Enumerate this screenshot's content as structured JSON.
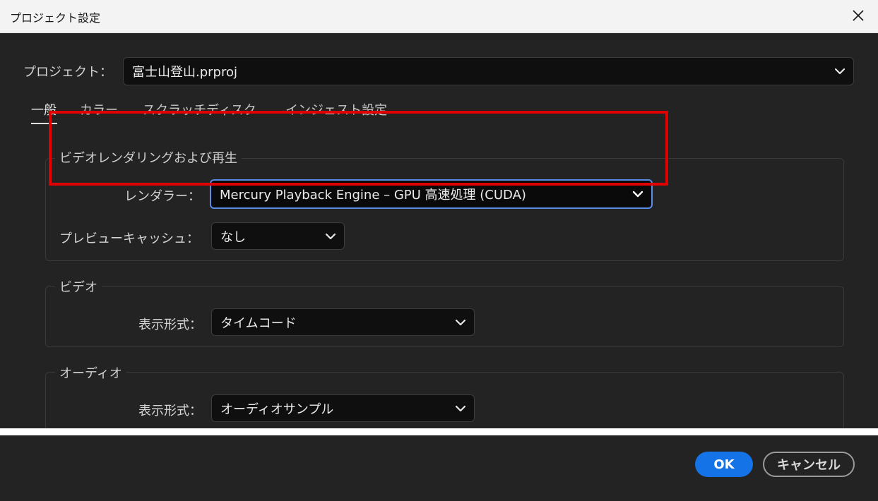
{
  "window": {
    "title": "プロジェクト設定"
  },
  "project": {
    "label": "プロジェクト：",
    "value": "富士山登山.prproj"
  },
  "tabs": [
    {
      "label": "一般",
      "active": true
    },
    {
      "label": "カラー",
      "active": false
    },
    {
      "label": "スクラッチディスク",
      "active": false
    },
    {
      "label": "インジェスト設定",
      "active": false
    }
  ],
  "video_rendering": {
    "title": "ビデオレンダリングおよび再生",
    "renderer_label": "レンダラー：",
    "renderer_value": "Mercury Playback Engine – GPU 高速処理 (CUDA)",
    "preview_cache_label": "プレビューキャッシュ：",
    "preview_cache_value": "なし"
  },
  "video": {
    "title": "ビデオ",
    "display_format_label": "表示形式：",
    "display_format_value": "タイムコード"
  },
  "audio": {
    "title": "オーディオ",
    "display_format_label": "表示形式：",
    "display_format_value": "オーディオサンプル"
  },
  "footer": {
    "ok_label": "OK",
    "cancel_label": "キャンセル"
  },
  "colors": {
    "background": "#232323",
    "accent": "#1473e6",
    "highlight": "#e00000",
    "focus_border": "#5a8ee6"
  },
  "icons": {
    "close": "close-icon",
    "dropdown": "chevron-down-icon"
  }
}
